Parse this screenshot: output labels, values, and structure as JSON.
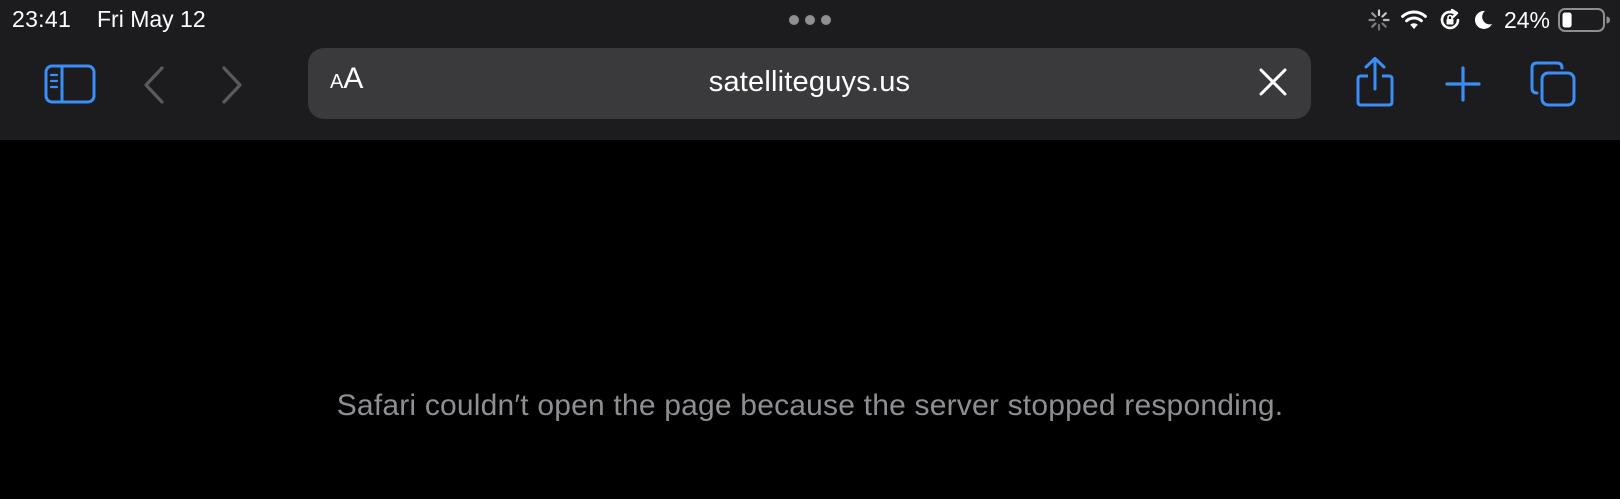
{
  "status_bar": {
    "time": "23:41",
    "date": "Fri May 12",
    "battery_percent": "24%",
    "battery_level": 0.24,
    "icons": [
      "activity-spinner-icon",
      "wifi-icon",
      "orientation-lock-icon",
      "do-not-disturb-moon-icon",
      "battery-icon"
    ],
    "multitasking_icon": "three-dots-icon"
  },
  "toolbar": {
    "sidebar_icon": "sidebar-icon",
    "back_icon": "chevron-left-icon",
    "forward_icon": "chevron-right-icon",
    "share_icon": "share-icon",
    "new_tab_icon": "plus-icon",
    "tabs_icon": "tabs-overview-icon"
  },
  "address_bar": {
    "reader_small": "A",
    "reader_large": "A",
    "url": "satelliteguys.us",
    "clear_icon": "close-x-icon"
  },
  "page": {
    "error_message": "Safari couldn′t open the page because the server stopped responding."
  },
  "colors": {
    "accent": "#3a8ef6",
    "chrome_bg": "#1c1c1e",
    "address_bg": "#3a3a3c",
    "page_bg": "#000000",
    "disabled": "#5a5a5e",
    "message_text": "#8e8e93"
  }
}
